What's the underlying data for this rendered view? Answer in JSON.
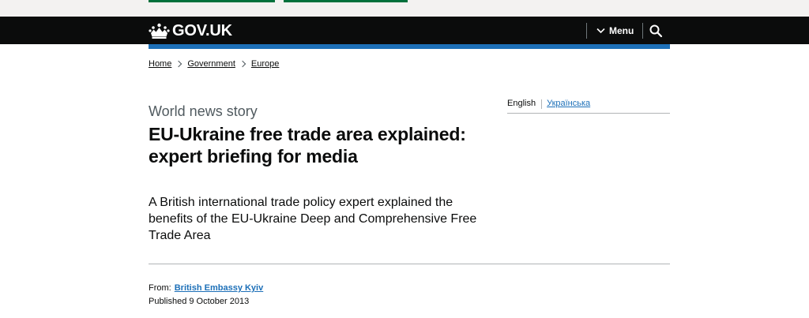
{
  "header": {
    "logo_text": "GOV.UK",
    "menu_label": "Menu",
    "colors": {
      "background": "#0b0c0c",
      "accent_bar": "#1d70b8",
      "top_button": "#00703c"
    }
  },
  "breadcrumbs": [
    {
      "label": "Home"
    },
    {
      "label": "Government"
    },
    {
      "label": "Europe"
    }
  ],
  "article": {
    "caption": "World news story",
    "title": "EU-Ukraine free trade area explained: expert briefing for media",
    "lead": "A British international trade policy expert explained the benefits of the EU-Ukraine Deep and Comprehensive Free Trade Area"
  },
  "languages": {
    "current": "English",
    "other": "Українська"
  },
  "metadata": {
    "from_label": "From:",
    "from_org": "British Embassy Kyiv",
    "published": "Published 9 October 2013"
  }
}
